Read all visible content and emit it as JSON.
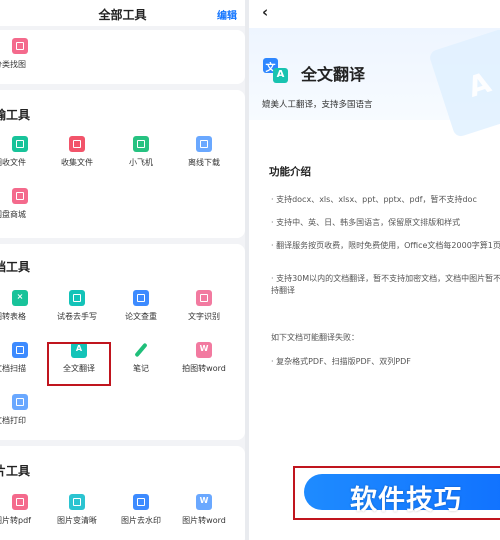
{
  "left": {
    "title": "全部工具",
    "edit": "编辑",
    "sec1": {
      "items": [
        {
          "label": "分类找图",
          "icon": "image-icon"
        }
      ]
    },
    "sec2": {
      "header": "输工具",
      "items": [
        {
          "label": "圈收文件",
          "icon": "inbox-icon"
        },
        {
          "label": "收集文件",
          "icon": "folder-icon"
        },
        {
          "label": "小飞机",
          "icon": "plane-icon"
        },
        {
          "label": "离线下载",
          "icon": "download-icon"
        },
        {
          "label": "网盘商城",
          "icon": "store-icon"
        }
      ]
    },
    "sec3": {
      "header": "档工具",
      "items": [
        {
          "label": "图转表格",
          "icon": "table-icon"
        },
        {
          "label": "试卷去手写",
          "icon": "paper-icon"
        },
        {
          "label": "论文查重",
          "icon": "search-doc-icon"
        },
        {
          "label": "文字识别",
          "icon": "ocr-icon"
        },
        {
          "label": "文档扫描",
          "icon": "scan-icon"
        },
        {
          "label": "全文翻译",
          "icon": "translate-icon"
        },
        {
          "label": "笔记",
          "icon": "pen-icon"
        },
        {
          "label": "拍图转word",
          "icon": "word-icon"
        },
        {
          "label": "文档打印",
          "icon": "print-icon"
        }
      ]
    },
    "sec4": {
      "header": "片工具",
      "items": [
        {
          "label": "图片转pdf",
          "icon": "pdf-icon"
        },
        {
          "label": "图片变清晰",
          "icon": "enhance-icon"
        },
        {
          "label": "图片去水印",
          "icon": "watermark-remove-icon"
        },
        {
          "label": "图片转word",
          "icon": "image-word-icon"
        }
      ]
    }
  },
  "right": {
    "title": "全文翻译",
    "subtitle": "媲美人工翻译，支持多国语言",
    "intro_header": "功能介绍",
    "paragraphs": [
      "· 支持docx、xls、xlsx、ppt、pptx、pdf，暂不支持doc",
      "· 支持中、英、日、韩多国语言，保留原文排版和样式",
      "· 翻译服务按页收费，限时免费使用，Office文档每2000字算1页",
      "· 支持30M以内的文档翻译，暂不支持加密文档，文档中图片暂不支持翻译",
      "如下文档可能翻译失败：",
      "· 复杂格式PDF、扫描版PDF、双列PDF"
    ],
    "watermark": "软件技巧"
  }
}
